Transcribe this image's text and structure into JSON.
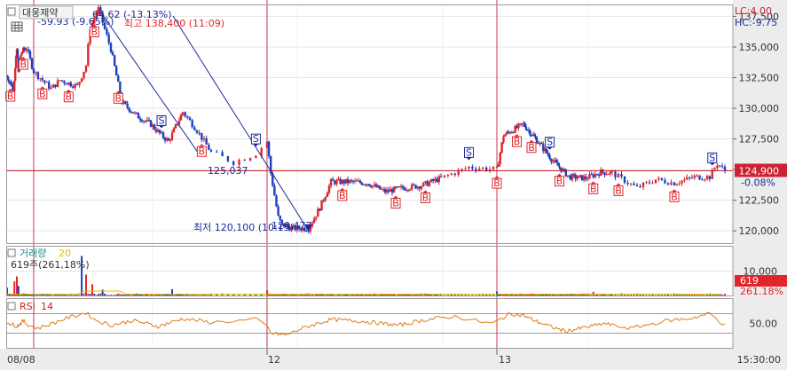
{
  "header": {
    "checkbox_label": "",
    "stock_name": "대웅제약",
    "lc_label": "LC:4.00",
    "hc_label": "HC:-9.75"
  },
  "colors": {
    "up": "#e0262b",
    "down": "#1e3fbf",
    "hline": "#cc2233",
    "vline": "#c8364a",
    "trend": "#1b2a9a",
    "rsi": "#e07b18",
    "volume_label": "#1a8a8a",
    "volume_ma": "#e0c000",
    "grid": "#e4e4e4",
    "axis_bg": "#ececec",
    "rsi_label": "#d02020"
  },
  "chart_data": [
    {
      "type": "line",
      "title": "대웅제약",
      "ylim": [
        119000,
        138400
      ],
      "yticks": [
        "137,500",
        "135,000",
        "132,500",
        "130,000",
        "127,500",
        "125,000",
        "122,500",
        "120,000"
      ],
      "ytick_values": [
        137500,
        135000,
        132500,
        130000,
        127500,
        125000,
        122500,
        120000
      ],
      "xtick_labels": [
        "08/08",
        "12",
        "13"
      ],
      "xtick_at_index": [
        0,
        126,
        236
      ],
      "n_bars": 347,
      "x_at_index": [
        0,
        24,
        28,
        52,
        64,
        78,
        96,
        104,
        116,
        126,
        136,
        150,
        168,
        184,
        204,
        220,
        236,
        252,
        262,
        290,
        306,
        326,
        346
      ],
      "series": [
        {
          "x_index": [
            0,
            8,
            12,
            14,
            18,
            24,
            28,
            36,
            40,
            48,
            52,
            54,
            58,
            64,
            70,
            78,
            86,
            92,
            96,
            104,
            110,
            116,
            120,
            124,
            126,
            128,
            132,
            134,
            140,
            148,
            154,
            160,
            170,
            180,
            190,
            200,
            210,
            220,
            228,
            236,
            240,
            252,
            262,
            272,
            282,
            292,
            300,
            306,
            314,
            320,
            326,
            334,
            340,
            343,
            346
          ],
          "close": [
            132600,
            131600,
            134800,
            133200,
            134600,
            134900,
            133000,
            131600,
            132300,
            131800,
            133500,
            136600,
            138100,
            134800,
            130500,
            129400,
            128700,
            127800,
            127300,
            129700,
            128200,
            126400,
            125600,
            126300,
            127300,
            124700,
            121100,
            120500,
            120200,
            120200,
            121900,
            124000,
            124000,
            123900,
            123200,
            123500,
            123700,
            124300,
            125200,
            125000,
            127800,
            128700,
            127400,
            125700,
            124400,
            124300,
            124800,
            124700,
            123500,
            124200,
            123900,
            124400,
            124400,
            125500,
            124900
          ]
        }
      ],
      "last_price_label": "124,900",
      "last_change_label": "-0.08%",
      "annotations": {
        "high_label": "최고 138,400 (11:09)",
        "low_label": "최저 120,100 (10:13)",
        "fib1": "-59.93 (-9.65%)",
        "fib2": "64.62 (-13.13%)",
        "mid_price": "125,037",
        "low_price": "120,477"
      },
      "buy_markers": [
        4,
        20,
        32,
        44,
        56,
        68,
        112,
        166,
        196,
        212,
        236,
        248,
        258,
        276,
        296,
        308,
        326
      ],
      "sell_markers": [
        92,
        124,
        228,
        270,
        341
      ],
      "marker_labels": {
        "buy": "B",
        "sell": "S"
      }
    },
    {
      "type": "bar",
      "title": "거래량",
      "ma_label": "20",
      "info_label": "619주(261,18%)",
      "ylim": [
        0,
        20000
      ],
      "yticks": [
        "10,000"
      ],
      "ytick_values": [
        10000
      ],
      "last_value_label": "619",
      "last_pct_label": "261.18%",
      "spikes": [
        {
          "index": 0,
          "value": 3200
        },
        {
          "index": 9,
          "value": 5800
        },
        {
          "index": 12,
          "value": 7800
        },
        {
          "index": 14,
          "value": 3900
        },
        {
          "index": 50,
          "value": 16200
        },
        {
          "index": 52,
          "value": 8500
        },
        {
          "index": 55,
          "value": 4600
        },
        {
          "index": 60,
          "value": 2400
        },
        {
          "index": 98,
          "value": 2600
        },
        {
          "index": 126,
          "value": 2100
        },
        {
          "index": 236,
          "value": 1600
        },
        {
          "index": 296,
          "value": 1500
        }
      ]
    },
    {
      "type": "line",
      "title": "RSI",
      "period": "14",
      "ylim": [
        0,
        100
      ],
      "yticks": [
        "50.00"
      ],
      "ytick_values": [
        50
      ],
      "upper": 70,
      "lower": 30,
      "x_index": [
        0,
        12,
        20,
        30,
        44,
        52,
        56,
        64,
        76,
        90,
        104,
        116,
        124,
        128,
        136,
        146,
        160,
        178,
        198,
        210,
        224,
        234,
        244,
        252,
        262,
        270,
        280,
        292,
        302,
        312,
        324,
        332,
        340,
        346
      ],
      "values": [
        52,
        44,
        55,
        40,
        62,
        72,
        58,
        46,
        56,
        44,
        60,
        52,
        58,
        30,
        26,
        42,
        58,
        54,
        46,
        56,
        64,
        50,
        70,
        66,
        54,
        44,
        34,
        42,
        50,
        40,
        56,
        60,
        70,
        46
      ]
    }
  ],
  "footer": {
    "x_start": "08/08",
    "x_day2": "12",
    "x_day3": "13",
    "time_label": "15:30:00"
  }
}
